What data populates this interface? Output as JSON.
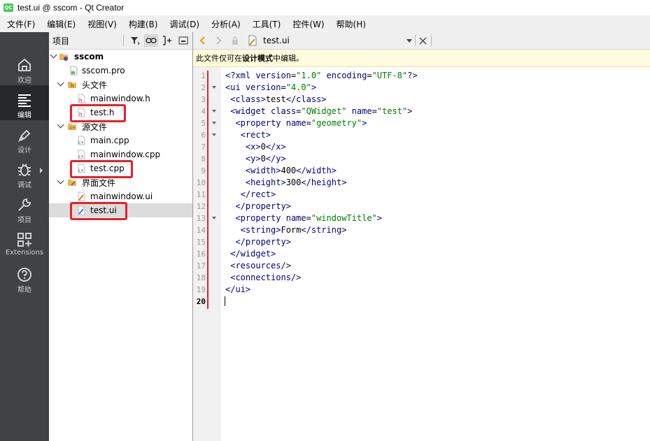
{
  "window": {
    "title": "test.ui @ sscom - Qt Creator",
    "logo": "QC"
  },
  "menu": [
    "文件(F)",
    "编辑(E)",
    "视图(V)",
    "构建(B)",
    "调试(D)",
    "分析(A)",
    "工具(T)",
    "控件(W)",
    "帮助(H)"
  ],
  "modes": [
    {
      "label": "欢迎",
      "icon": "home-icon"
    },
    {
      "label": "编辑",
      "icon": "edit-lines-icon"
    },
    {
      "label": "设计",
      "icon": "pen-icon"
    },
    {
      "label": "调试",
      "icon": "bug-icon"
    },
    {
      "label": "项目",
      "icon": "wrench-icon"
    },
    {
      "label": "Extensions",
      "icon": "extensions-icon"
    },
    {
      "label": "帮助",
      "icon": "help-icon"
    }
  ],
  "project": {
    "title": "项目",
    "root": "sscom",
    "pro_file": "sscom.pro",
    "headers_label": "头文件",
    "headers": [
      "mainwindow.h",
      "test.h"
    ],
    "sources_label": "源文件",
    "sources": [
      "main.cpp",
      "mainwindow.cpp",
      "test.cpp"
    ],
    "forms_label": "界面文件",
    "forms": [
      "mainwindow.ui",
      "test.ui"
    ]
  },
  "editor": {
    "file_name": "test.ui",
    "info_prefix": "此文件仅可在",
    "info_bold": "设计模式",
    "info_suffix": "中编辑。",
    "line_numbers": [
      "1",
      "2",
      "3",
      "4",
      "5",
      "6",
      "7",
      "8",
      "9",
      "10",
      "11",
      "12",
      "13",
      "14",
      "15",
      "16",
      "17",
      "18",
      "19",
      "20"
    ],
    "current_line": "20"
  },
  "colors": {
    "tag": "#000080",
    "string": "#008000",
    "modebar": "#404244",
    "highlight": "#e8202a"
  }
}
